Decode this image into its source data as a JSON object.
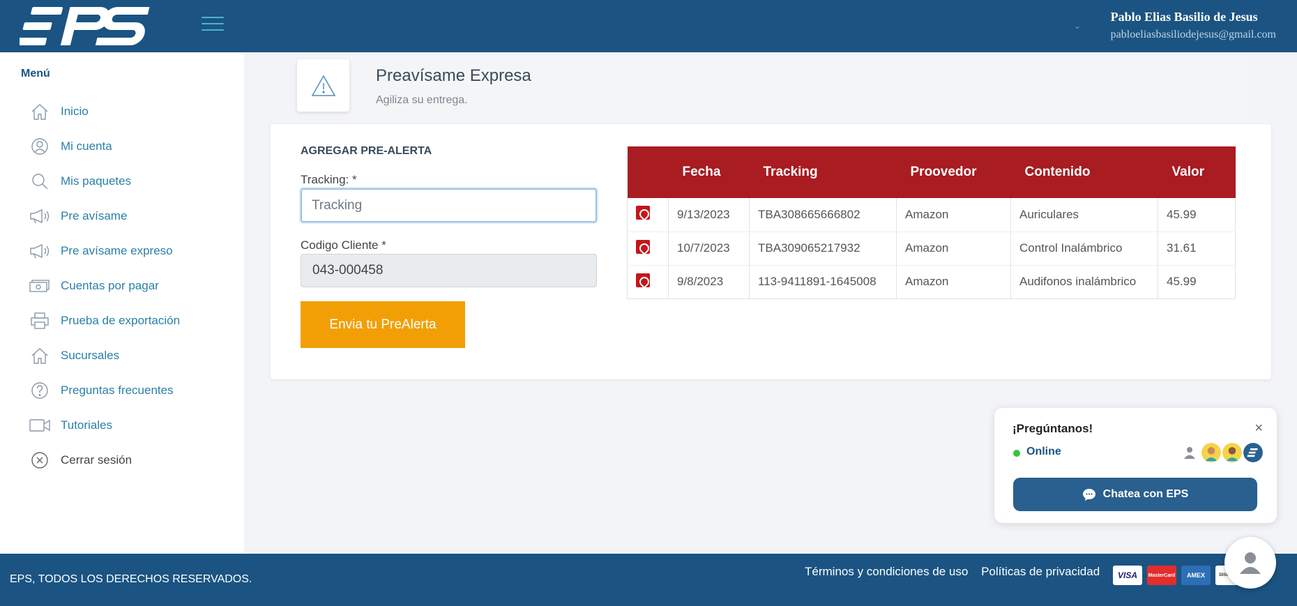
{
  "header": {
    "logo_text": "EPS",
    "user_name": "Pablo Elias Basilio de Jesus",
    "user_email": "pabloeliasbasiliodejesus@gmail.com"
  },
  "sidebar": {
    "title": "Menú",
    "items": [
      {
        "label": "Inicio",
        "icon": "home-icon"
      },
      {
        "label": "Mi cuenta",
        "icon": "user-icon"
      },
      {
        "label": "Mis paquetes",
        "icon": "search-icon"
      },
      {
        "label": "Pre avísame",
        "icon": "megaphone-icon"
      },
      {
        "label": "Pre avísame expreso",
        "icon": "megaphone-icon"
      },
      {
        "label": "Cuentas por pagar",
        "icon": "money-icon"
      },
      {
        "label": "Prueba de exportación",
        "icon": "printer-icon"
      },
      {
        "label": "Sucursales",
        "icon": "home-icon"
      },
      {
        "label": "Preguntas frecuentes",
        "icon": "question-icon"
      },
      {
        "label": "Tutoriales",
        "icon": "video-icon"
      },
      {
        "label": "Cerrar sesión",
        "icon": "close-circle-icon"
      }
    ]
  },
  "page": {
    "title": "Preavísame Expresa",
    "subtitle": "Agiliza su entrega."
  },
  "form": {
    "title": "AGREGAR PRE-ALERTA",
    "tracking_label": "Tracking: *",
    "tracking_placeholder": "Tracking",
    "codigo_label": "Codigo Cliente *",
    "codigo_value": "043-000458",
    "submit_label": "Envia tu PreAlerta"
  },
  "table": {
    "headers": [
      "",
      "Fecha",
      "Tracking",
      "Proovedor",
      "Contenido",
      "Valor"
    ],
    "rows": [
      {
        "fecha": "9/13/2023",
        "tracking": "TBA308665666802",
        "proveedor": "Amazon",
        "contenido": "Auriculares",
        "valor": "45.99"
      },
      {
        "fecha": "10/7/2023",
        "tracking": "TBA309065217932",
        "proveedor": "Amazon",
        "contenido": "Control Inalámbrico",
        "valor": "31.61"
      },
      {
        "fecha": "9/8/2023",
        "tracking": "113-9411891-1645008",
        "proveedor": "Amazon",
        "contenido": "Audifonos inalámbrico",
        "valor": "45.99"
      }
    ]
  },
  "chat": {
    "title": "¡Pregúntanos!",
    "status": "Online",
    "button_label": "Chatea con EPS",
    "close": "×"
  },
  "footer": {
    "copyright": "EPS, TODOS LOS DERECHOS RESERVADOS.",
    "terms": "Términos y condiciones de uso",
    "privacy": "Políticas de privacidad",
    "cards": [
      "VISA",
      "MasterCard",
      "AMEX",
      "DISCOVER"
    ]
  },
  "colors": {
    "brand": "#1b5482",
    "table_header": "#a81c22",
    "accent": "#f29f05",
    "online": "#3cc23c"
  }
}
